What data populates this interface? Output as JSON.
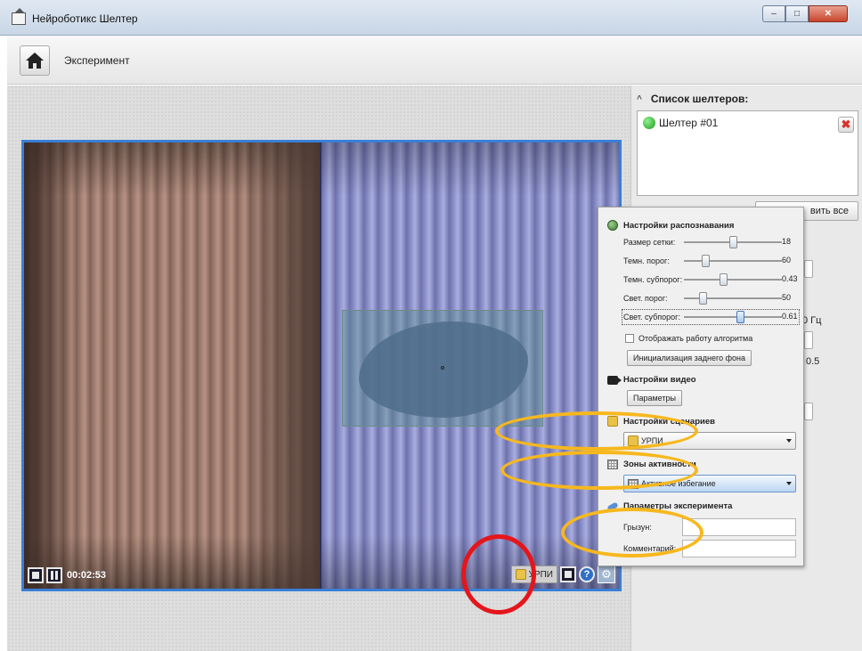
{
  "window": {
    "title": "Нейроботикс Шелтер",
    "min": "–",
    "max": "□",
    "close": "✕"
  },
  "header": {
    "title": "Эксперимент"
  },
  "video": {
    "timer": "00:02:53",
    "scenario_chip": "УРПИ"
  },
  "sidebar": {
    "list_title": "Список шелтеров:",
    "shelters": [
      {
        "label": "Шелтер #01",
        "status_color": "#1e9b1e"
      }
    ],
    "btn_fragment": "вить все",
    "frag_hz": "0 Гц",
    "frag_05": "0.5"
  },
  "settings": {
    "recognition": {
      "title": "Настройки распознавания",
      "rows": [
        {
          "label": "Размер сетки:",
          "value": "18",
          "pos": 0.5
        },
        {
          "label": "Темн. порог:",
          "value": "60",
          "pos": 0.2
        },
        {
          "label": "Темн. субпорог:",
          "value": "0.43",
          "pos": 0.4
        },
        {
          "label": "Свет. порог:",
          "value": "50",
          "pos": 0.17
        },
        {
          "label": "Свет. субпорог:",
          "value": "0.61",
          "pos": 0.58
        }
      ],
      "checkbox_label": "Отображать работу алгоритма",
      "init_button": "Инициализация заднего фона"
    },
    "video": {
      "title": "Настройки видео",
      "params_button": "Параметры"
    },
    "scenarios": {
      "title": "Настройки сценариев",
      "selected": "УРПИ"
    },
    "zones": {
      "title": "Зоны активности",
      "selected": "Активное избегание"
    },
    "experiment": {
      "title": "Параметры эксперимента",
      "rodent_label": "Грызун:",
      "comment_label": "Комментарий:",
      "rodent_value": "",
      "comment_value": ""
    }
  },
  "colors": {
    "accent": "#3a7fd6",
    "highlight_yellow": "#f7b81e",
    "highlight_red": "#e5161b"
  }
}
